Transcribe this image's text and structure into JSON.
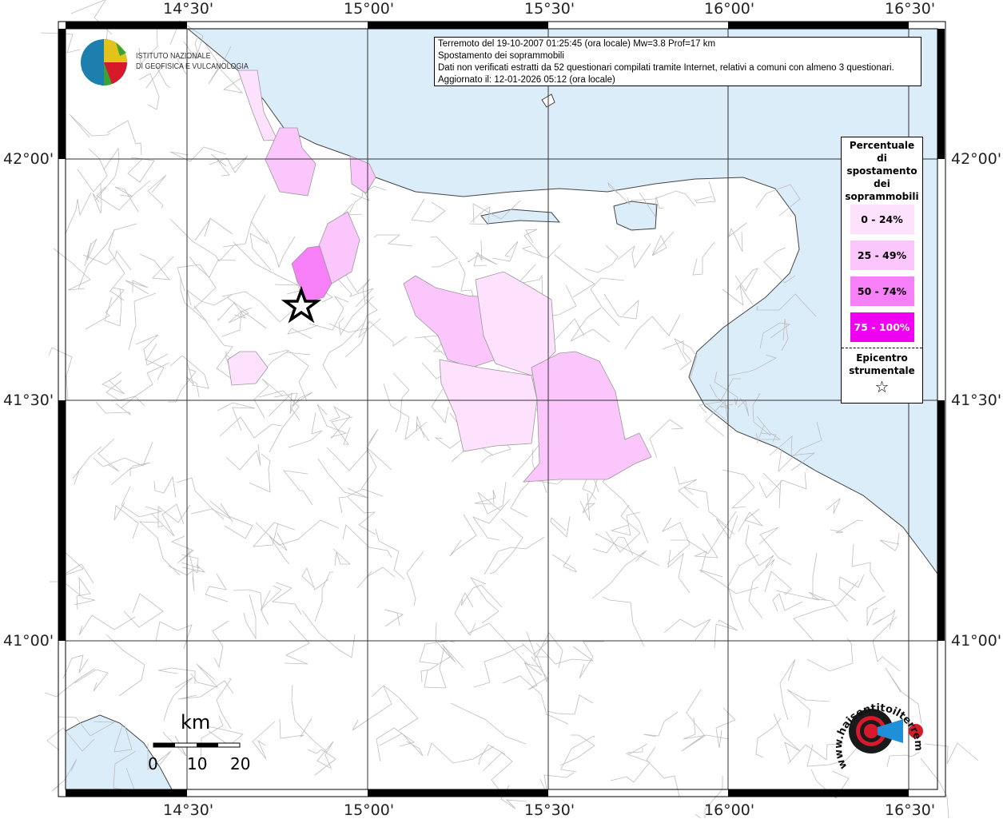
{
  "info_box": {
    "lines": [
      "Terremoto del 19-10-2007 01:25:45 (ora locale) Mw=3.8 Prof=17 km",
      "Spostamento dei soprammobili",
      "Dati non verificati estratti da 52 questionari compilati tramite Internet, relativi a comuni con almeno 3 questionari.",
      "Aggiornato il: 12-01-2026 05:12 (ora locale)"
    ]
  },
  "institute_logo": {
    "line1": "ISTITUTO NAZIONALE",
    "line2": "DI GEOFISICA E VULCANOLOGIA"
  },
  "legend": {
    "title": [
      "Percentuale",
      "di",
      "spostamento",
      "dei",
      "soprammobili"
    ],
    "classes": [
      {
        "label": "0 - 24%",
        "color": "#fde1fd"
      },
      {
        "label": "25 - 49%",
        "color": "#fbc6fb"
      },
      {
        "label": "50 - 74%",
        "color": "#f77ff7"
      },
      {
        "label": "75 - 100%",
        "color": "#f000f0"
      }
    ],
    "epicenter_label": [
      "Epicentro",
      "strumentale"
    ]
  },
  "axes": {
    "longitude_ticks": [
      "14°30'",
      "15°00'",
      "15°30'",
      "16°00'",
      "16°30'"
    ],
    "latitude_ticks": [
      "42°00'",
      "41°30'",
      "41°00'"
    ]
  },
  "scale_bar": {
    "unit": "km",
    "labels": [
      "0",
      "10",
      "20"
    ]
  },
  "site_logo": {
    "text": "www.haisentitoilterremoto.it"
  },
  "colors": {
    "sea": "#dcedfa",
    "land": "#ffffff",
    "boundary": "#b8b8b8"
  }
}
